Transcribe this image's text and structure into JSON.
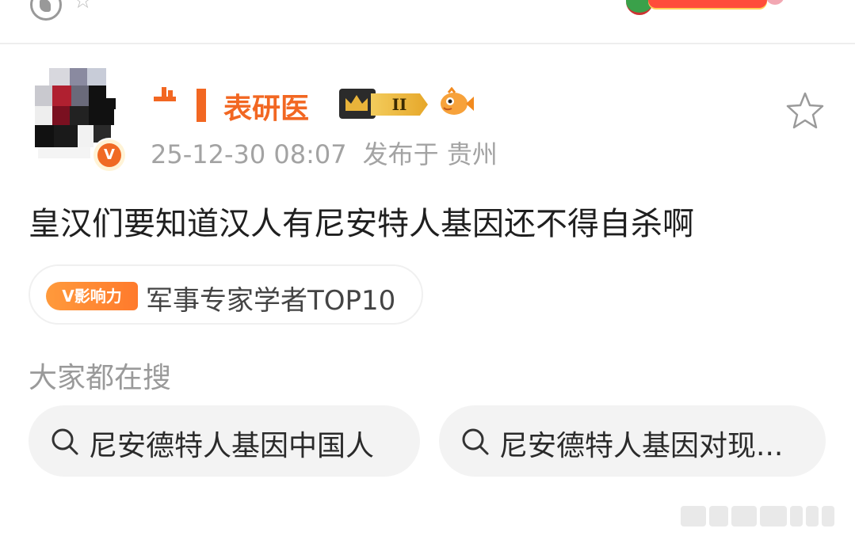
{
  "user": {
    "name": "表研医",
    "level_badge": "II",
    "verified_label": "V"
  },
  "post": {
    "timestamp": "25-12-30 08:07",
    "location": "发布于 贵州",
    "text": "皇汉们要知道汉人有尼安特人基因还不得自杀啊"
  },
  "influence": {
    "tag": "V影响力",
    "label": "军事专家学者TOP10"
  },
  "trending": {
    "title": "大家都在搜",
    "items": [
      {
        "label": "尼安德特人基因中国人"
      },
      {
        "label": "尼安德特人基因对现..."
      }
    ]
  },
  "colors": {
    "accent": "#f26722",
    "muted": "#a3a3a3",
    "chip_bg": "#f3f3f3"
  },
  "icons": {
    "star": "star-icon",
    "search": "search-icon",
    "fish": "fish-emoji-icon"
  }
}
